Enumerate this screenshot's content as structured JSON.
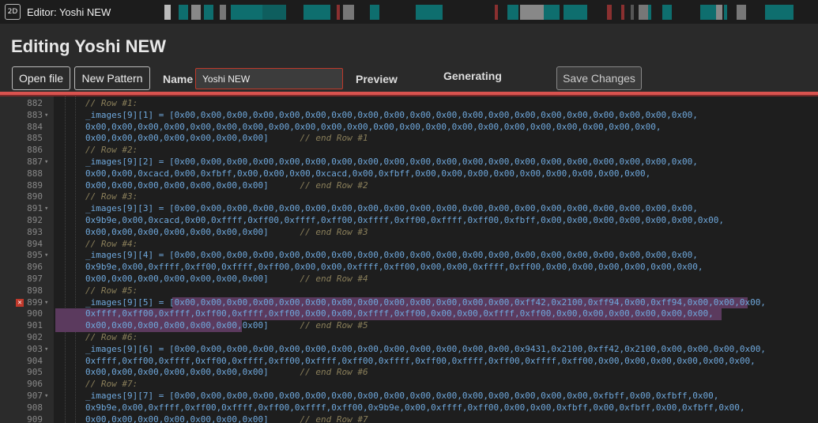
{
  "window": {
    "icon_text": "2D",
    "title": "Editor: Yoshi NEW"
  },
  "page": {
    "heading": "Editing Yoshi NEW"
  },
  "toolbar": {
    "open_file": "Open file",
    "new_pattern": "New Pattern",
    "name_label": "Name",
    "name_value": "Yoshi NEW",
    "preview_label": "Preview",
    "generating_label": "Generating",
    "save_changes": "Save Changes"
  },
  "colors": {
    "accent_red": "#d9534f",
    "code_blue": "#6fa8dc",
    "comment": "#8a7f5a",
    "highlight": "#5b3a5e"
  },
  "editor": {
    "error_line": "899",
    "lines": [
      {
        "n": "882",
        "fold": false,
        "code": "",
        "comment": "// Row #1:"
      },
      {
        "n": "883",
        "fold": true,
        "code": "_images[9][1] = [0x00,0x00,0x00,0x00,0x00,0x00,0x00,0x00,0x00,0x00,0x00,0x00,0x00,0x00,0x00,0x00,0x00,0x00,0x00,0x00,",
        "comment": ""
      },
      {
        "n": "884",
        "fold": false,
        "code": "0x00,0x00,0x00,0x00,0x00,0x00,0x00,0x00,0x00,0x00,0x00,0x00,0x00,0x00,0x00,0x00,0x00,0x00,0x00,0x00,0x00,0x00,",
        "comment": ""
      },
      {
        "n": "885",
        "fold": false,
        "code": "0x00,0x00,0x00,0x00,0x00,0x00,0x00]      ",
        "comment": "// end Row #1"
      },
      {
        "n": "886",
        "fold": false,
        "code": "",
        "comment": "// Row #2:"
      },
      {
        "n": "887",
        "fold": true,
        "code": "_images[9][2] = [0x00,0x00,0x00,0x00,0x00,0x00,0x00,0x00,0x00,0x00,0x00,0x00,0x00,0x00,0x00,0x00,0x00,0x00,0x00,0x00,",
        "comment": ""
      },
      {
        "n": "888",
        "fold": false,
        "code": "0x00,0x00,0xcacd,0x00,0xfbff,0x00,0x00,0x00,0xcacd,0x00,0xfbff,0x00,0x00,0x00,0x00,0x00,0x00,0x00,0x00,0x00,",
        "comment": ""
      },
      {
        "n": "889",
        "fold": false,
        "code": "0x00,0x00,0x00,0x00,0x00,0x00,0x00]      ",
        "comment": "// end Row #2"
      },
      {
        "n": "890",
        "fold": false,
        "code": "",
        "comment": "// Row #3:"
      },
      {
        "n": "891",
        "fold": true,
        "code": "_images[9][3] = [0x00,0x00,0x00,0x00,0x00,0x00,0x00,0x00,0x00,0x00,0x00,0x00,0x00,0x00,0x00,0x00,0x00,0x00,0x00,0x00,",
        "comment": ""
      },
      {
        "n": "892",
        "fold": false,
        "code": "0x9b9e,0x00,0xcacd,0x00,0xffff,0xff00,0xffff,0xff00,0xffff,0xff00,0xffff,0xff00,0xfbff,0x00,0x00,0x00,0x00,0x00,0x00,0x00,",
        "comment": ""
      },
      {
        "n": "893",
        "fold": false,
        "code": "0x00,0x00,0x00,0x00,0x00,0x00,0x00]      ",
        "comment": "// end Row #3"
      },
      {
        "n": "894",
        "fold": false,
        "code": "",
        "comment": "// Row #4:"
      },
      {
        "n": "895",
        "fold": true,
        "code": "_images[9][4] = [0x00,0x00,0x00,0x00,0x00,0x00,0x00,0x00,0x00,0x00,0x00,0x00,0x00,0x00,0x00,0x00,0x00,0x00,0x00,0x00,",
        "comment": ""
      },
      {
        "n": "896",
        "fold": false,
        "code": "0x9b9e,0x00,0xffff,0xff00,0xffff,0xff00,0x00,0x00,0xffff,0xff00,0x00,0x00,0xffff,0xff00,0x00,0x00,0x00,0x00,0x00,0x00,",
        "comment": ""
      },
      {
        "n": "897",
        "fold": false,
        "code": "0x00,0x00,0x00,0x00,0x00,0x00,0x00]      ",
        "comment": "// end Row #4"
      },
      {
        "n": "898",
        "fold": false,
        "code": "",
        "comment": "// Row #5:"
      },
      {
        "n": "899",
        "fold": true,
        "code": "_images[9][5] = [0x00,0x00,0x00,0x00,0x00,0x00,0x00,0x00,0x00,0x00,0x00,0x00,0x00,0xff42,0x2100,0xff94,0x00,0xff94,0x00,0x00,0x00,",
        "comment": ""
      },
      {
        "n": "900",
        "fold": false,
        "code": "0xffff,0xff00,0xffff,0xff00,0xffff,0xff00,0x00,0x00,0xffff,0xff00,0x00,0x00,0xffff,0xff00,0x00,0x00,0x00,0x00,0x00,0x00,",
        "comment": ""
      },
      {
        "n": "901",
        "fold": false,
        "code": "0x00,0x00,0x00,0x00,0x00,0x00,0x00]      ",
        "comment": "// end Row #5"
      },
      {
        "n": "902",
        "fold": false,
        "code": "",
        "comment": "// Row #6:"
      },
      {
        "n": "903",
        "fold": true,
        "code": "_images[9][6] = [0x00,0x00,0x00,0x00,0x00,0x00,0x00,0x00,0x00,0x00,0x00,0x00,0x00,0x9431,0x2100,0xff42,0x2100,0x00,0x00,0x00,0x00,",
        "comment": ""
      },
      {
        "n": "904",
        "fold": false,
        "code": "0xffff,0xff00,0xffff,0xff00,0xffff,0xff00,0xffff,0xff00,0xffff,0xff00,0xffff,0xff00,0xffff,0xff00,0x00,0x00,0x00,0x00,0x00,0x00,",
        "comment": ""
      },
      {
        "n": "905",
        "fold": false,
        "code": "0x00,0x00,0x00,0x00,0x00,0x00,0x00]      ",
        "comment": "// end Row #6"
      },
      {
        "n": "906",
        "fold": false,
        "code": "",
        "comment": "// Row #7:"
      },
      {
        "n": "907",
        "fold": true,
        "code": "_images[9][7] = [0x00,0x00,0x00,0x00,0x00,0x00,0x00,0x00,0x00,0x00,0x00,0x00,0x00,0x00,0x00,0x00,0xfbff,0x00,0xfbff,0x00,",
        "comment": ""
      },
      {
        "n": "908",
        "fold": false,
        "code": "0x9b9e,0x00,0xffff,0xff00,0xffff,0xff00,0xffff,0xff00,0x9b9e,0x00,0xffff,0xff00,0x00,0x00,0xfbff,0x00,0xfbff,0x00,0xfbff,0x00,",
        "comment": ""
      },
      {
        "n": "909",
        "fold": false,
        "code": "0x00,0x00,0x00,0x00,0x00,0x00,0x00]      ",
        "comment": "// end Row #7"
      }
    ]
  }
}
